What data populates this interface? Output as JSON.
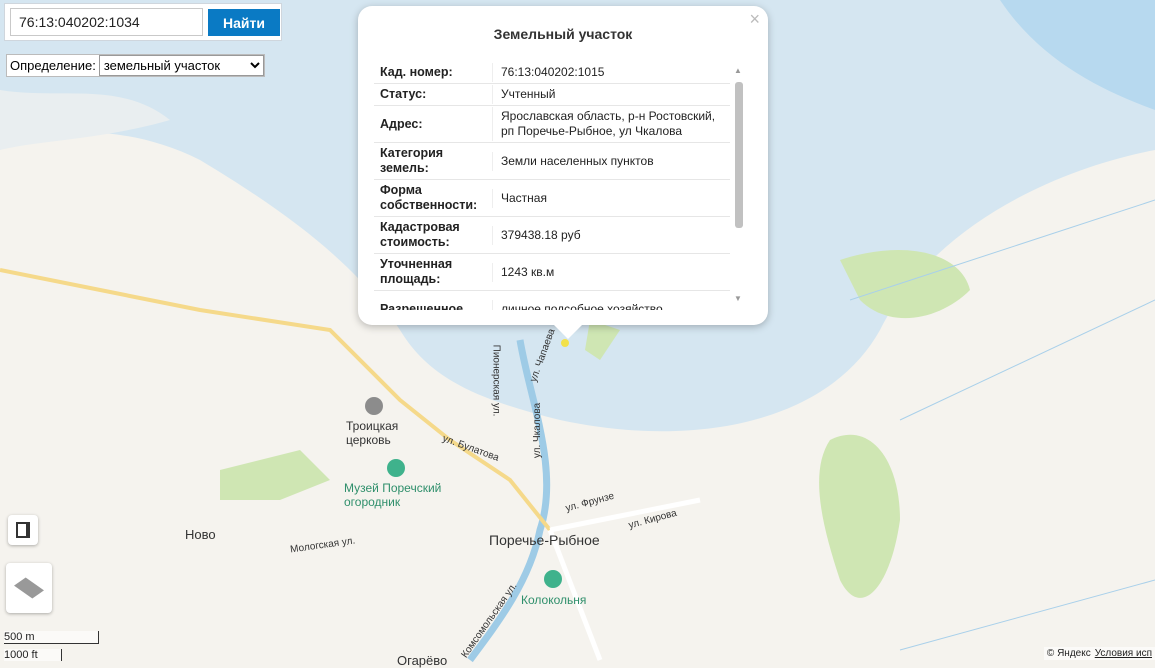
{
  "search": {
    "value": "76:13:040202:1034",
    "button": "Найти"
  },
  "definition": {
    "label": "Определение:",
    "selected": "земельный участок"
  },
  "popup": {
    "title": "Земельный участок",
    "close": "×",
    "rows": [
      {
        "key": "Кад. номер:",
        "value": "76:13:040202:1015"
      },
      {
        "key": "Статус:",
        "value": "Учтенный"
      },
      {
        "key": "Адрес:",
        "value": "Ярославская область, р-н Ростовский, рп Поречье-Рыбное, ул Чкалова"
      },
      {
        "key": "Категория земель:",
        "value": "Земли населенных пунктов"
      },
      {
        "key": "Форма собственности:",
        "value": "Частная"
      },
      {
        "key": "Кадастровая стоимость:",
        "value": "379438.18 руб"
      },
      {
        "key": "Уточненная площадь:",
        "value": "1243 кв.м"
      },
      {
        "key": "Разрешенное",
        "value": "личное подсобное хозяйство"
      }
    ]
  },
  "map_labels": {
    "church": "Троицкая церковь",
    "museum": "Музей Поречский огородник",
    "town": "Поречье-Рыбное",
    "bell": "Колокольня",
    "novo": "Ново",
    "ogarevo": "Огарёво",
    "st_bulatova": "ул. Булатова",
    "st_frunze": "ул. Фрунзе",
    "st_kirova": "ул. Кирова",
    "st_mologa": "Мологская ул.",
    "st_pioneer": "Пионерская ул.",
    "st_chkalova": "ул. Чкалова",
    "st_chapaeva": "ул. Чапаева",
    "st_komsomol": "Комсомольская ул."
  },
  "scale": {
    "metric": "500 m",
    "imperial": "1000 ft"
  },
  "footer": {
    "copyright": "© Яндекс",
    "terms": "Условия исп"
  }
}
